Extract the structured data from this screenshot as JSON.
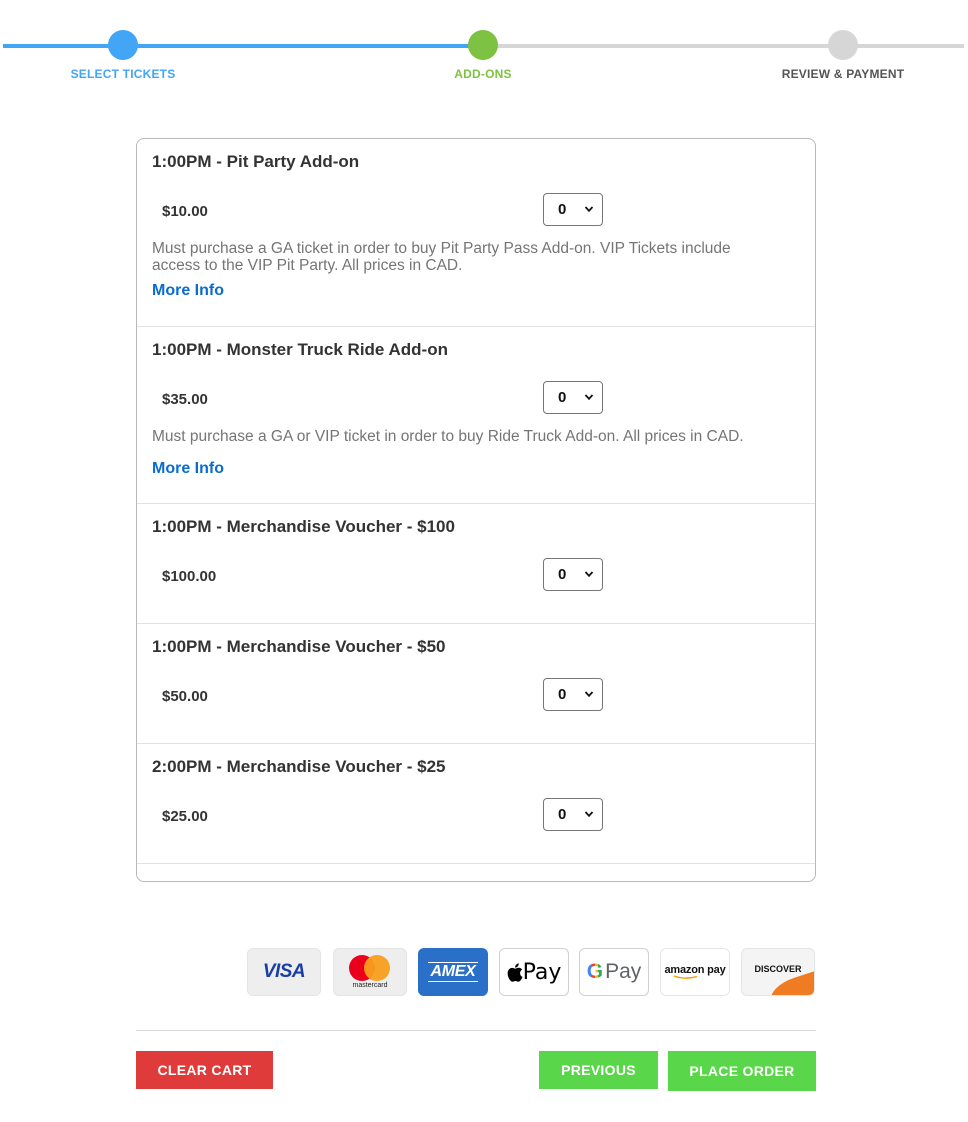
{
  "stepper": {
    "steps": [
      {
        "label": "SELECT TICKETS",
        "state": "done"
      },
      {
        "label": "ADD-ONS",
        "state": "current"
      },
      {
        "label": "REVIEW & PAYMENT",
        "state": "pending"
      }
    ],
    "colors": {
      "done": "#42a5f5",
      "current": "#7dc242",
      "pending": "#d6d6d6"
    }
  },
  "addons": [
    {
      "title": "1:00PM - Pit Party Add-on",
      "price": "$10.00",
      "quantity": "0",
      "description": "Must purchase a GA ticket in order to buy Pit Party Pass Add-on. VIP Tickets include access to the VIP Pit Party. All prices in CAD.",
      "more_info": "More Info"
    },
    {
      "title": "1:00PM - Monster Truck Ride Add-on",
      "price": "$35.00",
      "quantity": "0",
      "description": "Must purchase a GA or VIP ticket in order to buy Ride Truck Add-on. All prices in CAD.",
      "more_info": "More Info"
    },
    {
      "title": "1:00PM - Merchandise Voucher - $100",
      "price": "$100.00",
      "quantity": "0"
    },
    {
      "title": "1:00PM - Merchandise Voucher - $50",
      "price": "$50.00",
      "quantity": "0"
    },
    {
      "title": "2:00PM - Merchandise Voucher - $25",
      "price": "$25.00",
      "quantity": "0"
    }
  ],
  "payment_methods": {
    "visa": "VISA",
    "mastercard": "mastercard",
    "amex": "AMEX",
    "apple_pay": "Pay",
    "google_pay_g": "G",
    "google_pay": "Pay",
    "amazon_pay": "amazon pay",
    "discover": "DISCOVER"
  },
  "buttons": {
    "clear_cart": "CLEAR CART",
    "previous": "PREVIOUS",
    "place_order": "PLACE ORDER"
  },
  "colors": {
    "link": "#0a6ccf",
    "danger": "#e03b3b",
    "success": "#5ad64a"
  }
}
